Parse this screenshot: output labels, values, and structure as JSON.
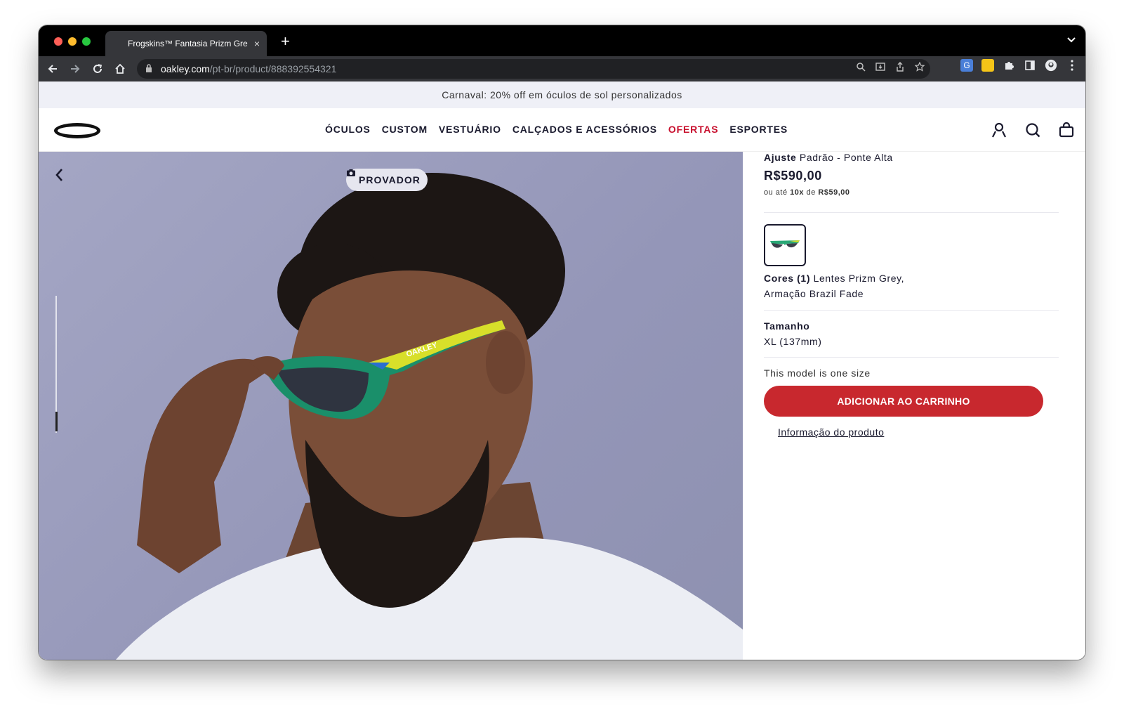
{
  "browser": {
    "tab_title": "Frogskins™ Fantasia Prizm Gre",
    "tab_close": "×",
    "new_tab": "+",
    "url_host": "oakley.com",
    "url_path": "/pt-br/product/888392554321"
  },
  "promo_banner": "Carnaval: 20% off em óculos de sol personalizados",
  "nav": {
    "items": [
      "ÓCULOS",
      "CUSTOM",
      "VESTUÁRIO",
      "CALÇADOS E ACESSÓRIOS",
      "OFERTAS",
      "ESPORTES"
    ],
    "sale_color": "#c8102e"
  },
  "hero": {
    "try_on_label": "PROVADOR",
    "frame_brand_text": "OAKLEY"
  },
  "product": {
    "fit_label": "Ajuste",
    "fit_value": "Padrão - Ponte Alta",
    "price": "R$590,00",
    "installments_prefix": "ou até",
    "installments_count": "10x",
    "installments_mid": "de",
    "installments_value": "R$59,00",
    "colors_label": "Cores (1)",
    "colors_value": "Lentes Prizm Grey, Armação Brazil Fade",
    "size_label": "Tamanho",
    "size_value": "XL (137mm)",
    "one_size_note": "This model is one size",
    "add_to_cart": "ADICIONAR AO CARRINHO",
    "product_info_link": "Informação do produto",
    "cta_color": "#c8282e"
  }
}
